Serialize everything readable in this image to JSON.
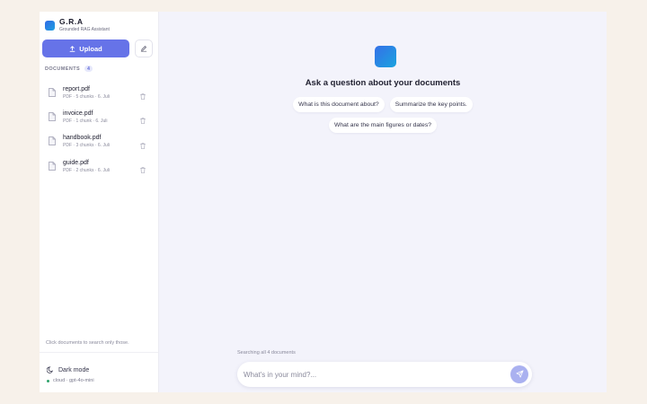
{
  "brand": {
    "name": "G.R.A",
    "subtitle": "Grounded RAG Assistant"
  },
  "sidebar": {
    "upload_label": "Upload",
    "documents_title": "DOCUMENTS",
    "documents_count": "4",
    "documents": [
      {
        "name": "report.pdf",
        "meta": "PDF · 5 chunks · 6. Juli"
      },
      {
        "name": "invoice.pdf",
        "meta": "PDF · 1 chunk · 6. Juli"
      },
      {
        "name": "handbook.pdf",
        "meta": "PDF · 3 chunks · 6. Juli"
      },
      {
        "name": "guide.pdf",
        "meta": "PDF · 2 chunks · 6. Juli"
      }
    ],
    "hint": "Click documents to search only those.",
    "dark_mode_label": "Dark mode",
    "model_status": "cloud · gpt-4o-mini"
  },
  "main": {
    "heading": "Ask a question about your documents",
    "suggestions": [
      "What is this document about?",
      "Summarize the key points.",
      "What are the main figures or dates?"
    ],
    "search_scope": "Searching all 4 documents",
    "input_placeholder": "What's in your mind?..."
  },
  "colors": {
    "accent": "#6673e8",
    "send_button": "#aab1f0",
    "status_online": "#2fa36b",
    "logo_gradient": [
      "#3570e8",
      "#1aa3df"
    ]
  },
  "icons": {
    "upload": "upload-icon",
    "edit": "pencil-icon",
    "file": "file-icon",
    "trash": "trash-icon",
    "dark_mode": "moon-icon",
    "send": "send-icon"
  }
}
